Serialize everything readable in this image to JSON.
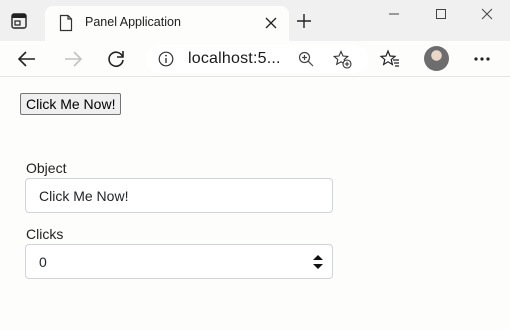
{
  "browser": {
    "tab": {
      "title": "Panel Application"
    },
    "address": {
      "url": "localhost:5..."
    }
  },
  "page": {
    "button": {
      "label": "Click Me Now!"
    },
    "object_field": {
      "label": "Object",
      "value": "Click Me Now!"
    },
    "clicks_field": {
      "label": "Clicks",
      "value": "0"
    }
  },
  "icons": {
    "tab_actions": "tab-actions-icon",
    "favicon": "page-icon",
    "tab_close": "close-icon",
    "new_tab": "plus-icon",
    "back": "back-arrow-icon",
    "forward": "forward-arrow-icon",
    "reload": "reload-icon",
    "site_info": "info-icon",
    "zoom": "zoom-icon",
    "add_favorite": "star-add-icon",
    "favorites": "favorites-icon",
    "menu": "more-icon"
  }
}
